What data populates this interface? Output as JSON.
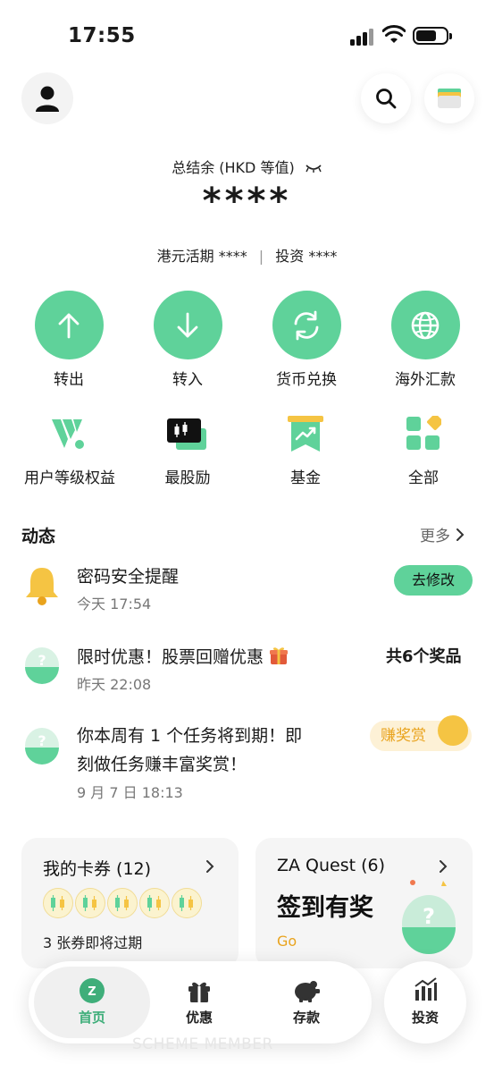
{
  "status_bar": {
    "time": "17:55"
  },
  "header": {
    "balance_label": "总结余 (HKD 等值)",
    "balance_value": "****",
    "hkd_savings": "港元活期 ****",
    "investment": "投资 ****",
    "separator": "|"
  },
  "actions": [
    {
      "label": "转出",
      "icon": "arrow-up-icon"
    },
    {
      "label": "转入",
      "icon": "arrow-down-icon"
    },
    {
      "label": "货币兑换",
      "icon": "exchange-icon"
    },
    {
      "label": "海外汇款",
      "icon": "globe-icon"
    }
  ],
  "tools": [
    {
      "label": "用户等级权益",
      "icon": "tier-icon"
    },
    {
      "label": "最股励",
      "icon": "stock-card-icon"
    },
    {
      "label": "基金",
      "icon": "fund-icon"
    },
    {
      "label": "全部",
      "icon": "grid-icon"
    }
  ],
  "feed": {
    "title": "动态",
    "more": "更多",
    "items": [
      {
        "text": "密码安全提醒",
        "time": "今天 17:54",
        "action": "去修改"
      },
      {
        "text": "限时优惠！股票回赠优惠",
        "time": "昨天 22:08",
        "action": "共6个奖品"
      },
      {
        "text_line1": "你本周有 1 个任务将到期！即",
        "text_line2": "刻做任务赚丰富奖赏！",
        "time": "9 月 7 日 18:13",
        "action": "赚奖赏"
      }
    ]
  },
  "cards": {
    "coupons": {
      "title": "我的卡券 (12)",
      "subtitle": "3 张券即将过期"
    },
    "quest": {
      "title": "ZA Quest (6)",
      "headline": "签到有奖",
      "cta": "Go"
    }
  },
  "nav": {
    "items": [
      {
        "label": "首页",
        "icon": "home-logo-icon"
      },
      {
        "label": "优惠",
        "icon": "gift-icon"
      },
      {
        "label": "存款",
        "icon": "piggy-bank-icon"
      }
    ],
    "invest": {
      "label": "投资",
      "icon": "bar-chart-icon"
    }
  },
  "watermark": "SCHEME MEMBER",
  "colors": {
    "accent": "#5fd29a",
    "warning": "#f5c443",
    "reward": "#e9a31d"
  }
}
